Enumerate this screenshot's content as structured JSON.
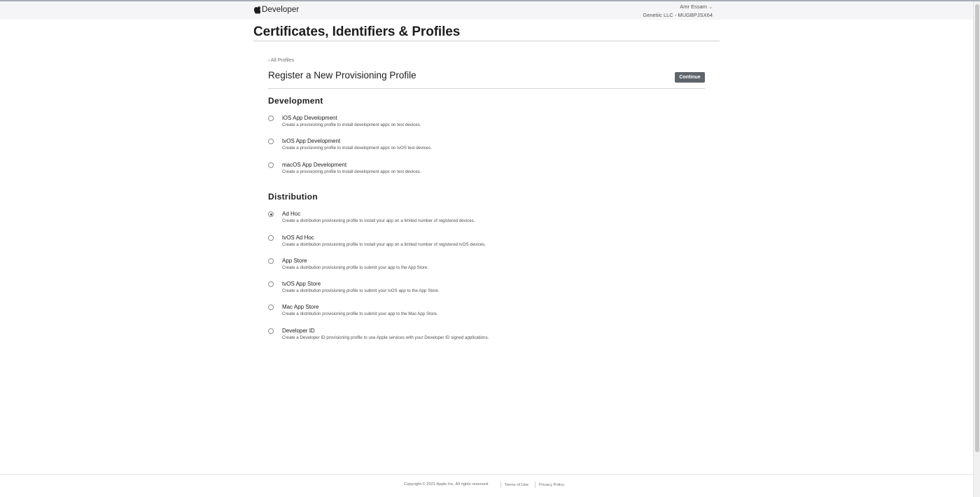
{
  "nav": {
    "brand": "Developer",
    "account_name": "Amr Essam",
    "account_team": "Genetiic LLC - MUGBPJSX64"
  },
  "page": {
    "title": "Certificates, Identifiers & Profiles"
  },
  "form": {
    "back_link": "‹ All Profiles",
    "title": "Register a New Provisioning Profile",
    "continue_label": "Continue"
  },
  "sections": [
    {
      "title": "Development",
      "options": [
        {
          "label": "iOS App Development",
          "description": "Create a provisioning profile to install development apps on test devices.",
          "selected": false
        },
        {
          "label": "tvOS App Development",
          "description": "Create a provisioning profile to install development apps on tvOS test devices.",
          "selected": false
        },
        {
          "label": "macOS App Development",
          "description": "Create a provisioning profile to install development apps on test devices.",
          "selected": false
        }
      ]
    },
    {
      "title": "Distribution",
      "options": [
        {
          "label": "Ad Hoc",
          "description": "Create a distribution provisioning profile to install your app on a limited number of registered devices.",
          "selected": true
        },
        {
          "label": "tvOS Ad Hoc",
          "description": "Create a distribution provisioning profile to install your app on a limited number of registered tvOS devices.",
          "selected": false
        },
        {
          "label": "App Store",
          "description": "Create a distribution provisioning profile to submit your app to the App Store.",
          "selected": false
        },
        {
          "label": "tvOS App Store",
          "description": "Create a distribution provisioning profile to submit your tvOS app to the App Store.",
          "selected": false
        },
        {
          "label": "Mac App Store",
          "description": "Create a distribution provisioning profile to submit your app to the Mac App Store.",
          "selected": false
        },
        {
          "label": "Developer ID",
          "description": "Create a Developer ID provisioning profile to use Apple services with your Developer ID signed applications.",
          "selected": false
        }
      ]
    }
  ],
  "footer": {
    "copyright": "Copyright © 2021 Apple Inc. All rights reserved.",
    "terms": "Terms of Use",
    "privacy": "Privacy Policy"
  },
  "colors": {
    "continue_button": "#5e646b",
    "nav_background": "#f5f5f7"
  }
}
